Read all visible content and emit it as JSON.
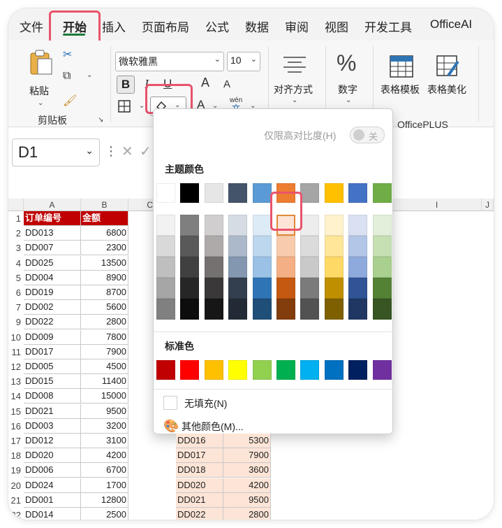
{
  "menubar": {
    "tabs": [
      "文件",
      "开始",
      "插入",
      "页面布局",
      "公式",
      "数据",
      "审阅",
      "视图",
      "开发工具",
      "OfficeAI"
    ],
    "active_tab": "开始"
  },
  "ribbon": {
    "clipboard": {
      "paste_label": "粘贴",
      "group_label": "剪贴板"
    },
    "font": {
      "font_name": "微软雅黑",
      "font_size": "10",
      "bold": "B",
      "italic": "I",
      "underline": "U",
      "grow": "A",
      "shrink": "A",
      "font_color": "A",
      "phonetic": "wén",
      "phonetic_sub": "文"
    },
    "align": {
      "label": "对齐方式"
    },
    "number": {
      "symbol": "%",
      "label": "数字"
    },
    "officeplus": {
      "template_label": "表格模板",
      "beautify_label": "表格美化",
      "group_label": "OfficePLUS"
    }
  },
  "formula_bar": {
    "name_box": "D1"
  },
  "grid": {
    "columns": [
      "A",
      "B",
      "C",
      "I",
      "J"
    ],
    "rows": [
      "1",
      "2",
      "3",
      "4",
      "5",
      "6",
      "7",
      "9",
      "10",
      "11",
      "12",
      "13",
      "14",
      "15",
      "16",
      "17",
      "18",
      "19",
      "20",
      "21",
      "22"
    ],
    "headers": [
      "订单编号",
      "金额"
    ],
    "left_data": [
      [
        "DD013",
        "6800"
      ],
      [
        "DD007",
        "2300"
      ],
      [
        "DD025",
        "13500"
      ],
      [
        "DD004",
        "8900"
      ],
      [
        "DD019",
        "8700"
      ],
      [
        "DD002",
        "5600"
      ],
      [
        "DD022",
        "2800"
      ],
      [
        "DD009",
        "7800"
      ],
      [
        "DD017",
        "7900"
      ],
      [
        "DD005",
        "4500"
      ],
      [
        "DD015",
        "11400"
      ],
      [
        "DD008",
        "15000"
      ],
      [
        "DD021",
        "9500"
      ],
      [
        "DD003",
        "3200"
      ],
      [
        "DD012",
        "3100"
      ],
      [
        "DD020",
        "4200"
      ],
      [
        "DD006",
        "6700"
      ],
      [
        "DD024",
        "1700"
      ],
      [
        "DD001",
        "12800"
      ],
      [
        "DD014",
        "2500"
      ]
    ],
    "right_data": [
      [
        "DD016",
        "5300"
      ],
      [
        "DD017",
        "7900"
      ],
      [
        "DD018",
        "3600"
      ],
      [
        "DD020",
        "4200"
      ],
      [
        "DD021",
        "9500"
      ],
      [
        "DD022",
        "2800"
      ]
    ]
  },
  "fill_dropdown": {
    "high_contrast_label": "仅限高对比度(H)",
    "toggle_state": "关",
    "theme_colors_label": "主题颜色",
    "theme_top": [
      "#ffffff",
      "#000000",
      "#e7e6e6",
      "#44546a",
      "#5b9bd5",
      "#ed7d31",
      "#a5a5a5",
      "#ffc000",
      "#4472c4",
      "#70ad47"
    ],
    "theme_shades": [
      [
        "#f2f2f2",
        "#7f7f7f",
        "#d0cece",
        "#d6dce4",
        "#ddebf7",
        "#fce4d6",
        "#ededed",
        "#fff2cc",
        "#d9e1f2",
        "#e2efda"
      ],
      [
        "#d9d9d9",
        "#595959",
        "#aeaaaa",
        "#acb9ca",
        "#bdd7ee",
        "#f8cbad",
        "#dbdbdb",
        "#ffe699",
        "#b4c6e7",
        "#c6e0b4"
      ],
      [
        "#bfbfbf",
        "#404040",
        "#757171",
        "#8497b0",
        "#9bc2e6",
        "#f4b084",
        "#c9c9c9",
        "#ffd966",
        "#8ea9db",
        "#a9d08e"
      ],
      [
        "#a6a6a6",
        "#262626",
        "#3a3838",
        "#333f4f",
        "#2f75b5",
        "#c65911",
        "#7b7b7b",
        "#bf8f00",
        "#305496",
        "#548235"
      ],
      [
        "#808080",
        "#0d0d0d",
        "#161616",
        "#222b35",
        "#1f4e78",
        "#833c0c",
        "#525252",
        "#7f6000",
        "#203764",
        "#375623"
      ]
    ],
    "standard_colors_label": "标准色",
    "standard_colors": [
      "#c00000",
      "#ff0000",
      "#ffc000",
      "#ffff00",
      "#92d050",
      "#00b050",
      "#00b0f0",
      "#0070c0",
      "#002060",
      "#7030a0"
    ],
    "no_fill_label": "无填充(N)",
    "more_colors_label": "其他颜色(M)...",
    "selected_color": "#fce4d6"
  }
}
